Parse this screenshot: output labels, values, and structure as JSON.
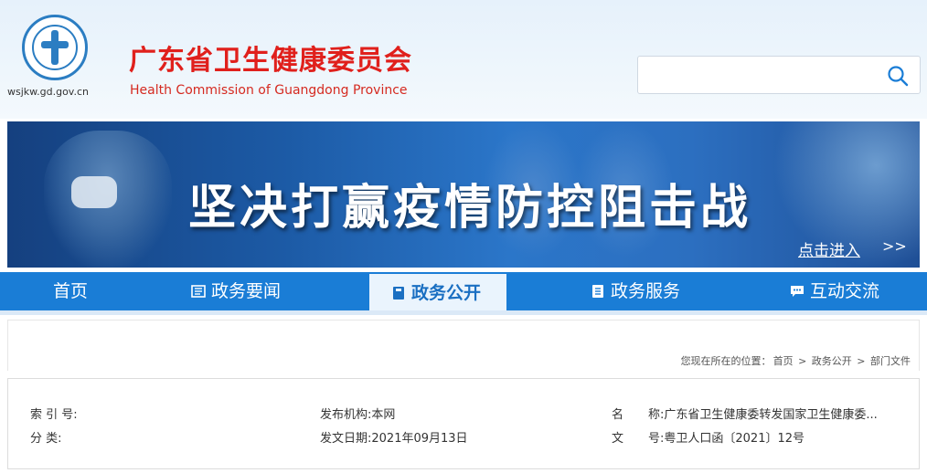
{
  "header": {
    "domain": "wsjkw.gd.gov.cn",
    "title_cn": "广东省卫生健康委员会",
    "title_en": "Health Commission of Guangdong Province",
    "search": {
      "placeholder": "",
      "icon": "search-icon"
    }
  },
  "banner": {
    "slogan": "坚决打赢疫情防控阻击战",
    "enter_label": "点击进入",
    "enter_arrow": ">>"
  },
  "nav": {
    "items": [
      {
        "label": "首页",
        "icon": ""
      },
      {
        "label": "政务要闻",
        "icon": "news-icon"
      },
      {
        "label": "政务公开",
        "icon": "book-icon",
        "active": true
      },
      {
        "label": "政务服务",
        "icon": "document-icon"
      },
      {
        "label": "互动交流",
        "icon": "chat-icon"
      }
    ]
  },
  "breadcrumb": {
    "prefix": "您现在所在的位置：",
    "items": [
      "首页",
      "政务公开",
      "部门文件"
    ],
    "separator": ">"
  },
  "info": {
    "index_label": "索 引 号:",
    "index_value": "",
    "category_label": "分       类:",
    "category_value": "",
    "publisher_label": "发布机构:",
    "publisher_value": "本网",
    "date_label": "发文日期:",
    "date_value": "2021年09月13日",
    "name_label1": "名",
    "name_label2": "称:",
    "name_value": "广东省卫生健康委转发国家卫生健康委...",
    "doc_label1": "文",
    "doc_label2": "号:",
    "doc_value": "粤卫人口函〔2021〕12号"
  },
  "colors": {
    "brand_red": "#e0201c",
    "nav_blue": "#1a7dd6",
    "active_tab_bg": "#eaf4fd"
  }
}
